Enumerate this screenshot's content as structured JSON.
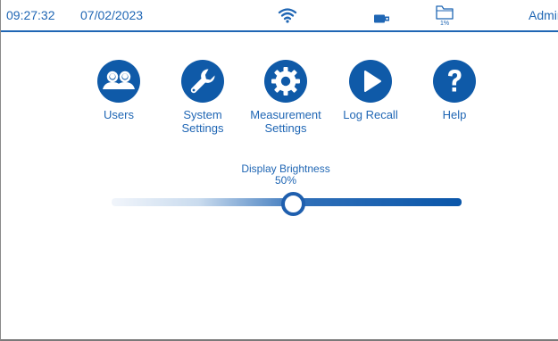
{
  "status_bar": {
    "time": "09:27:32",
    "date": "07/02/2023",
    "wifi_icon": "wifi-icon",
    "usb_icon": "usb-drive-icon",
    "storage_icon": "folder-icon",
    "storage_percent": "1%",
    "user": "Admin"
  },
  "menu": {
    "items": [
      {
        "label": "Users",
        "icon": "users-icon"
      },
      {
        "label": "System\nSettings",
        "icon": "wrench-icon"
      },
      {
        "label": "Measurement\nSettings",
        "icon": "gear-icon"
      },
      {
        "label": "Log Recall",
        "icon": "play-icon"
      },
      {
        "label": "Help",
        "icon": "question-icon"
      }
    ]
  },
  "brightness": {
    "label": "Display Brightness",
    "value_text": "50%",
    "value_fraction": 0.5
  },
  "colors": {
    "accent": "#1f66b4",
    "icon_fill": "#0f5aa8",
    "background": "#ffffff"
  }
}
